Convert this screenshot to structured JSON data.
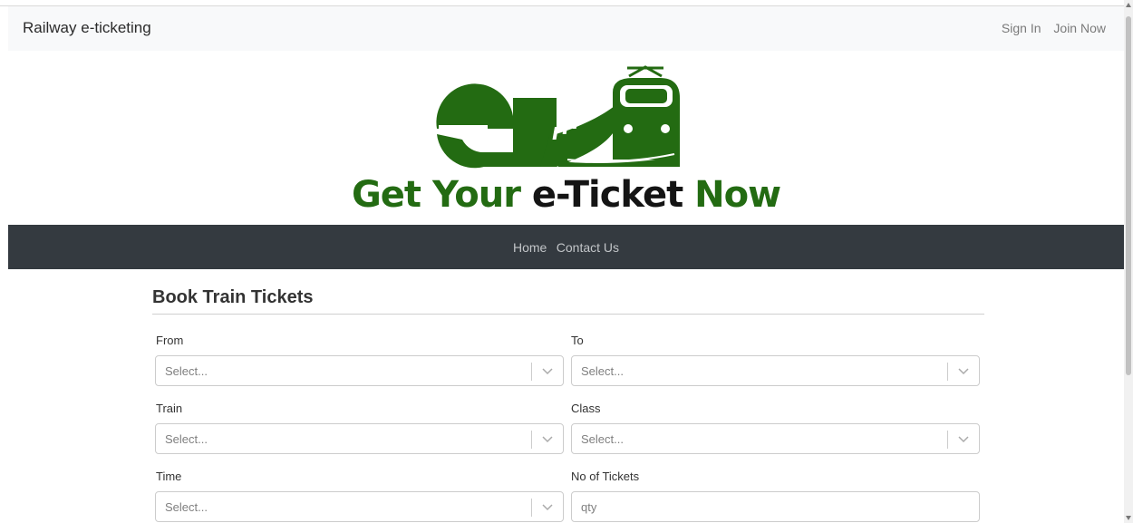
{
  "topbar": {
    "brand": "Railway e-ticketing",
    "links": [
      "Sign In",
      "Join Now"
    ]
  },
  "hero": {
    "tagline_part1": "Get Your ",
    "tagline_part2": "e-Ticket",
    "tagline_part3": " Now",
    "logo_icon": "train-logo-icon",
    "brand_green": "#236b12"
  },
  "mainnav": {
    "links": [
      "Home",
      "Contact Us"
    ],
    "background": "#343a40"
  },
  "form": {
    "title": "Book Train Tickets",
    "from_label": "From",
    "from_placeholder": "Select...",
    "to_label": "To",
    "to_placeholder": "Select...",
    "train_label": "Train",
    "train_placeholder": "Select...",
    "class_label": "Class",
    "class_placeholder": "Select...",
    "time_label": "Time",
    "time_placeholder": "Select...",
    "tickets_label": "No of Tickets",
    "tickets_placeholder": "qty"
  }
}
